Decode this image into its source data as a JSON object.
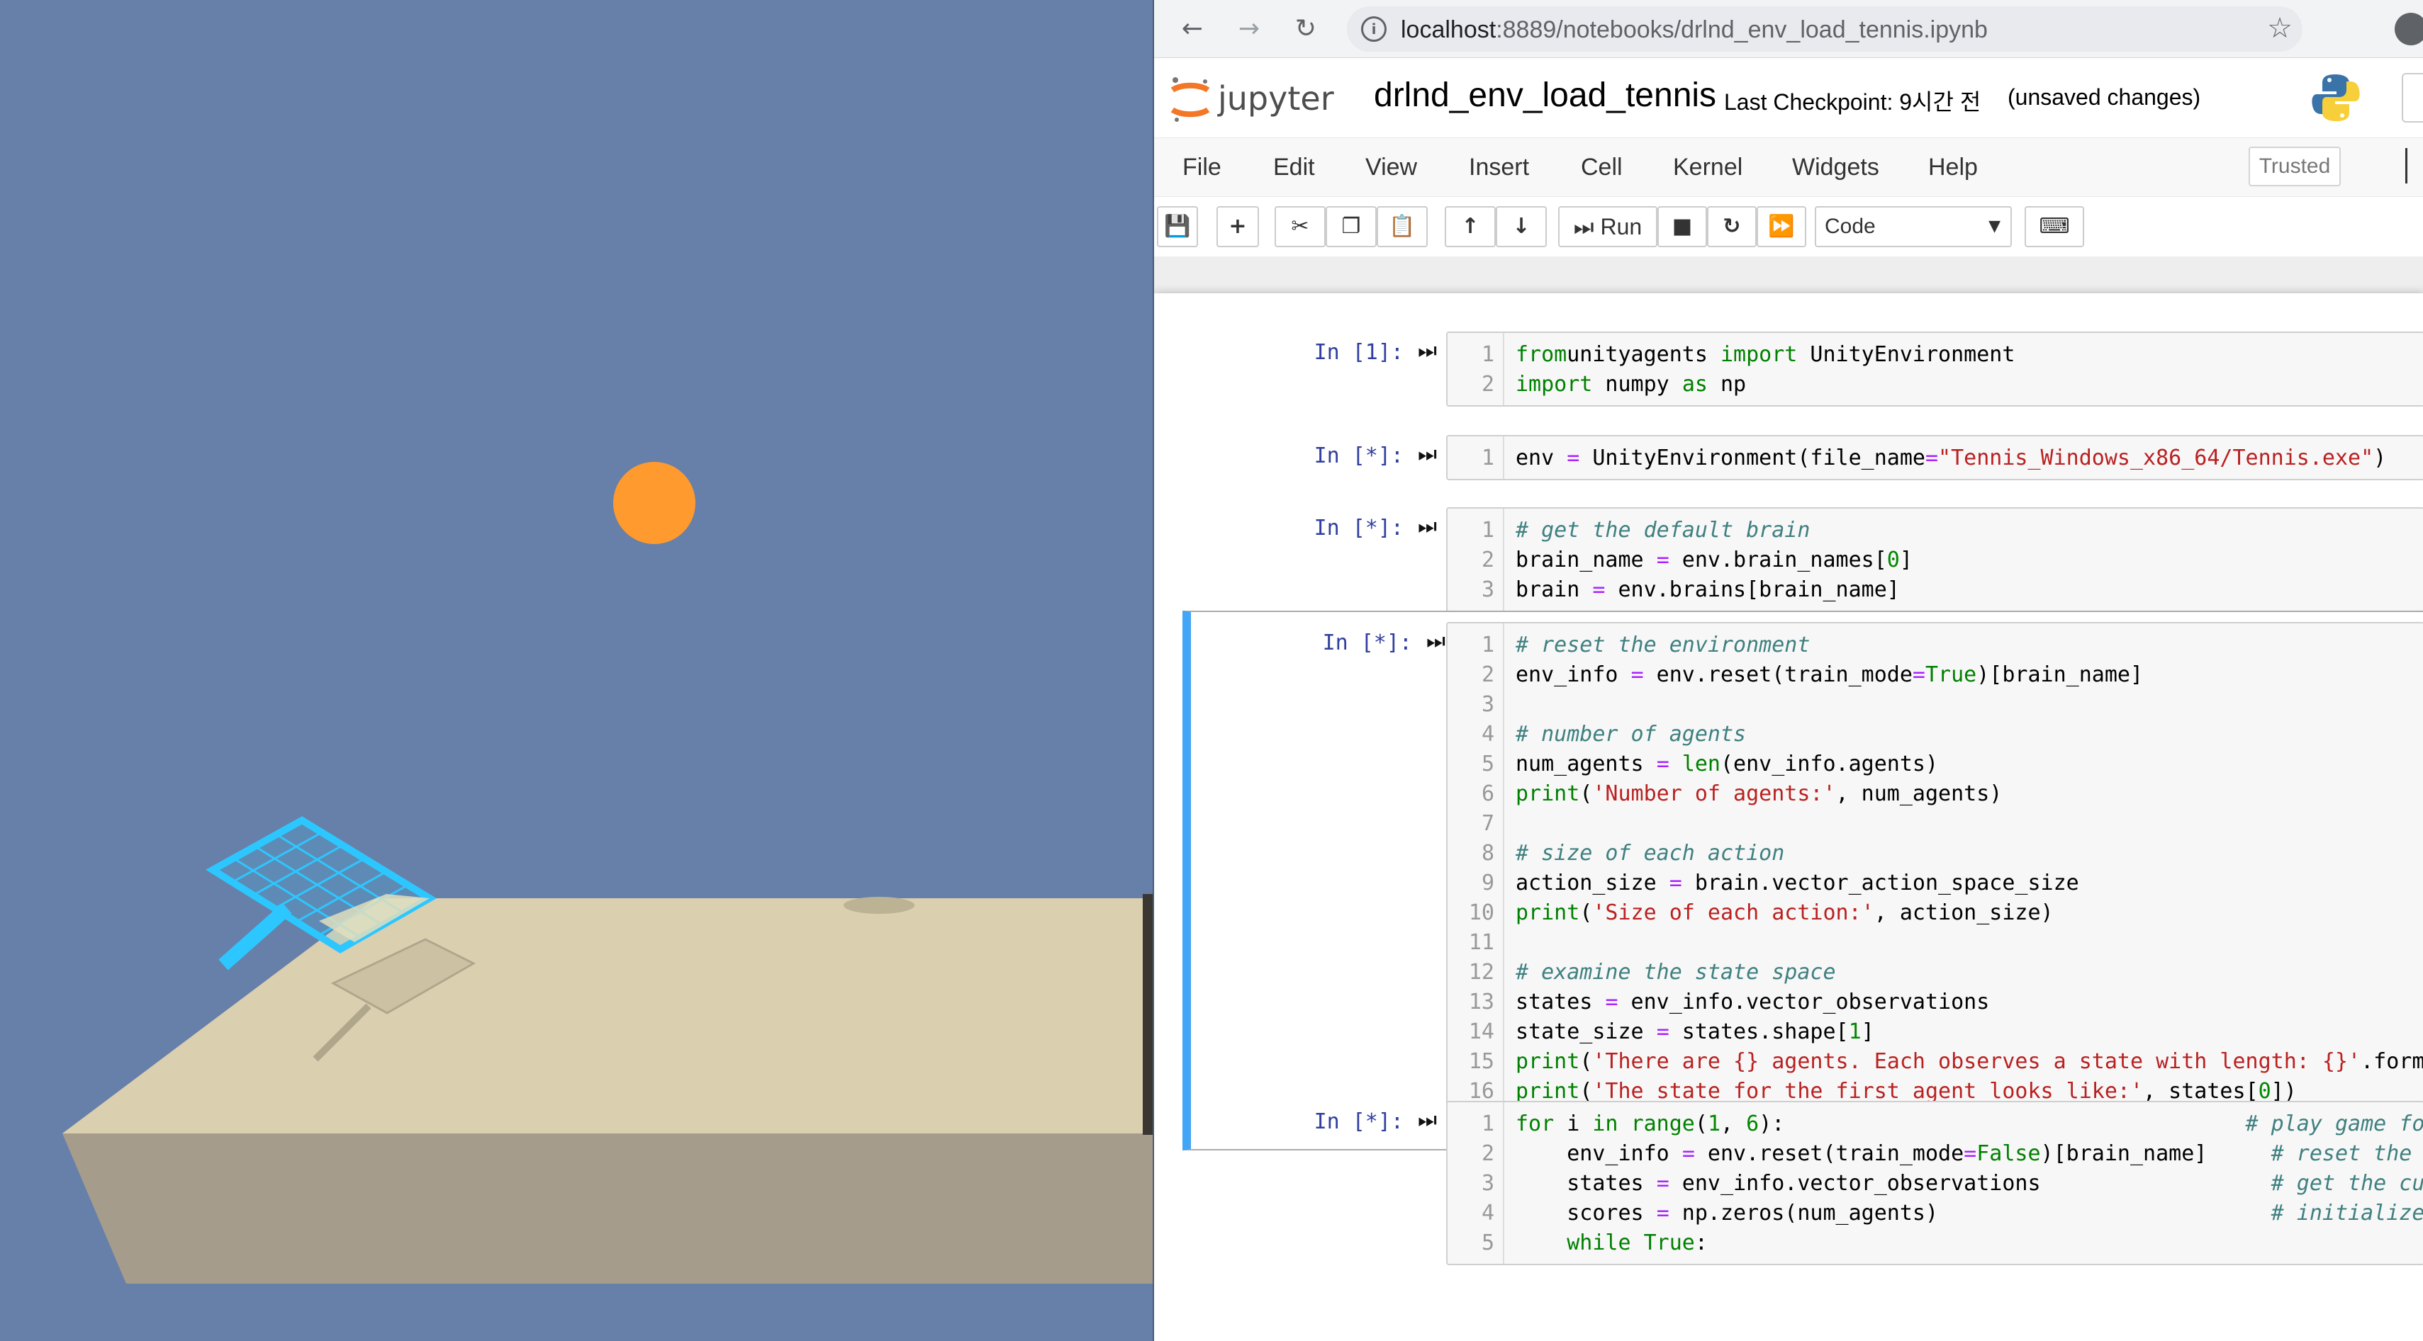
{
  "browser": {
    "url_host": "localhost",
    "url_rest": ":8889/notebooks/drlnd_env_load_tennis.ipynb",
    "back_icon": "←",
    "forward_icon": "→",
    "reload_icon": "↻",
    "info_icon": "i",
    "star_icon": "☆"
  },
  "jupyter": {
    "logo_text": "jupyter",
    "notebook_name": "drlnd_env_load_tennis",
    "checkpoint": "Last Checkpoint: 9시간 전",
    "status": "(unsaved changes)",
    "trusted": "Trusted"
  },
  "menu": [
    "File",
    "Edit",
    "View",
    "Insert",
    "Cell",
    "Kernel",
    "Widgets",
    "Help"
  ],
  "toolbar": {
    "save_icon": "💾",
    "add_icon": "+",
    "cut_icon": "✂",
    "copy_icon": "❐",
    "paste_icon": "📋",
    "up_icon": "↑",
    "down_icon": "↓",
    "run_label": "Run",
    "run_icon": "⏭",
    "stop_icon": "■",
    "restart_icon": "↻",
    "fast_forward_icon": "⏩",
    "cell_type": "Code",
    "keyboard_icon": "⌨"
  },
  "cells": [
    {
      "prompt": "In [1]:",
      "lines": [
        [
          [
            "kw",
            "from"
          ],
          [
            "",
            "unityagents "
          ],
          [
            "kw",
            "import"
          ],
          [
            "",
            " UnityEnvironment"
          ]
        ],
        [
          [
            "kw",
            "import"
          ],
          [
            "",
            " numpy "
          ],
          [
            "kw",
            "as"
          ],
          [
            "",
            " np"
          ]
        ]
      ]
    },
    {
      "prompt": "In [*]:",
      "lines": [
        [
          [
            "",
            "env "
          ],
          [
            "op",
            "="
          ],
          [
            "",
            " UnityEnvironment(file_name"
          ],
          [
            "op",
            "="
          ],
          [
            "st",
            "\"Tennis_Windows_x86_64/Tennis.exe\""
          ],
          [
            "",
            ")"
          ]
        ]
      ]
    },
    {
      "prompt": "In [*]:",
      "lines": [
        [
          [
            "cm",
            "# get the default brain"
          ]
        ],
        [
          [
            "",
            "brain_name "
          ],
          [
            "op",
            "="
          ],
          [
            "",
            " env.brain_names["
          ],
          [
            "nm",
            "0"
          ],
          [
            "",
            "]"
          ]
        ],
        [
          [
            "",
            "brain "
          ],
          [
            "op",
            "="
          ],
          [
            "",
            " env.brains[brain_name]"
          ]
        ]
      ]
    },
    {
      "prompt": "In [*]:",
      "selected": true,
      "lines": [
        [
          [
            "cm",
            "# reset the environment"
          ]
        ],
        [
          [
            "",
            "env_info "
          ],
          [
            "op",
            "="
          ],
          [
            "",
            " env.reset(train_mode"
          ],
          [
            "op",
            "="
          ],
          [
            "kw",
            "True"
          ],
          [
            "",
            ")[brain_name]"
          ]
        ],
        [],
        [
          [
            "cm",
            "# number of agents"
          ]
        ],
        [
          [
            "",
            "num_agents "
          ],
          [
            "op",
            "="
          ],
          [
            "",
            " "
          ],
          [
            "bi",
            "len"
          ],
          [
            "",
            "(env_info.agents)"
          ]
        ],
        [
          [
            "bi",
            "print"
          ],
          [
            "",
            "("
          ],
          [
            "st",
            "'Number of agents:'"
          ],
          [
            "",
            ", num_agents)"
          ]
        ],
        [],
        [
          [
            "cm",
            "# size of each action"
          ]
        ],
        [
          [
            "",
            "action_size "
          ],
          [
            "op",
            "="
          ],
          [
            "",
            " brain.vector_action_space_size"
          ]
        ],
        [
          [
            "bi",
            "print"
          ],
          [
            "",
            "("
          ],
          [
            "st",
            "'Size of each action:'"
          ],
          [
            "",
            ", action_size)"
          ]
        ],
        [],
        [
          [
            "cm",
            "# examine the state space"
          ]
        ],
        [
          [
            "",
            "states "
          ],
          [
            "op",
            "="
          ],
          [
            "",
            " env_info.vector_observations"
          ]
        ],
        [
          [
            "",
            "state_size "
          ],
          [
            "op",
            "="
          ],
          [
            "",
            " states.shape["
          ],
          [
            "nm",
            "1"
          ],
          [
            "",
            "]"
          ]
        ],
        [
          [
            "bi",
            "print"
          ],
          [
            "",
            "("
          ],
          [
            "st",
            "'There are {} agents. Each observes a state with length: {}'"
          ],
          [
            "",
            ".format"
          ]
        ],
        [
          [
            "bi",
            "print"
          ],
          [
            "",
            "("
          ],
          [
            "st",
            "'The state for the first agent looks like:'"
          ],
          [
            "",
            ", states["
          ],
          [
            "nm",
            "0"
          ],
          [
            "",
            "])"
          ]
        ]
      ]
    },
    {
      "prompt": "In [*]:",
      "lines": [
        [
          [
            "kw",
            "for"
          ],
          [
            "",
            " i "
          ],
          [
            "kw",
            "in"
          ],
          [
            "",
            " "
          ],
          [
            "bi",
            "range"
          ],
          [
            "",
            "("
          ],
          [
            "nm",
            "1"
          ],
          [
            "",
            ", "
          ],
          [
            "nm",
            "6"
          ],
          [
            "",
            "):                                    "
          ],
          [
            "cm",
            "# play game fo"
          ]
        ],
        [
          [
            "",
            "    env_info "
          ],
          [
            "op",
            "="
          ],
          [
            "",
            " env.reset(train_mode"
          ],
          [
            "op",
            "="
          ],
          [
            "kw",
            "False"
          ],
          [
            "",
            ")[brain_name]     "
          ],
          [
            "cm",
            "# reset the en"
          ]
        ],
        [
          [
            "",
            "    states "
          ],
          [
            "op",
            "="
          ],
          [
            "",
            " env_info.vector_observations                  "
          ],
          [
            "cm",
            "# get the curr"
          ]
        ],
        [
          [
            "",
            "    scores "
          ],
          [
            "op",
            "="
          ],
          [
            "",
            " np.zeros(num_agents)                          "
          ],
          [
            "cm",
            "# initialize t"
          ]
        ],
        [
          [
            "",
            "    "
          ],
          [
            "kw",
            "while"
          ],
          [
            "",
            " "
          ],
          [
            "kw",
            "True"
          ],
          [
            "",
            ":"
          ]
        ]
      ]
    }
  ]
}
